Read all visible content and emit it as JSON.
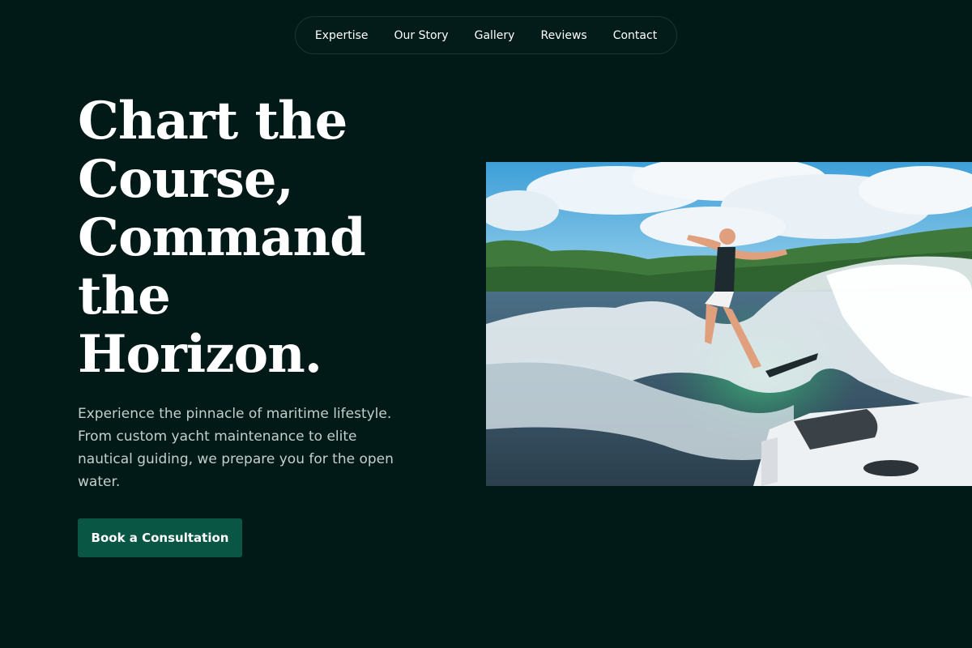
{
  "nav": {
    "items": [
      {
        "label": "Expertise"
      },
      {
        "label": "Our Story"
      },
      {
        "label": "Gallery"
      },
      {
        "label": "Reviews"
      },
      {
        "label": "Contact"
      }
    ]
  },
  "hero": {
    "headline_lines": [
      "Chart the",
      "Course,",
      "Command",
      "the",
      "Horizon."
    ],
    "lede": "Experience the pinnacle of maritime lifestyle. From custom yacht maintenance to elite nautical guiding, we prepare you for the open water.",
    "cta_label": "Book a Consultation",
    "image_icon": "wakeboarder-photo"
  },
  "colors": {
    "background": "#021a17",
    "accent": "#0a5644",
    "nav_border": "#1d3531",
    "text_primary": "#ffffff",
    "text_muted": "#c4cfcc"
  }
}
